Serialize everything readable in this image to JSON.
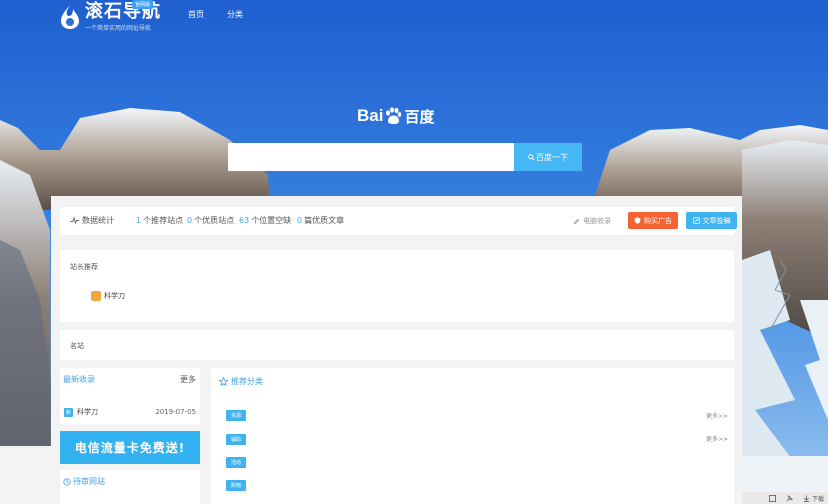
{
  "header": {
    "logo_title": "滚石导航",
    "logo_subtitle": "一个简单实用的网址导航",
    "logo_badge": "官网版",
    "nav": [
      "首页",
      "分类"
    ]
  },
  "search": {
    "brand_latin": "Bai",
    "brand_cn": "百度",
    "placeholder": "",
    "button_label": "百度一下"
  },
  "stats": {
    "label": "数据统计",
    "items": [
      {
        "num": "1",
        "text": "个推荐站点"
      },
      {
        "num": "0",
        "text": "个优质站点"
      },
      {
        "num": "63",
        "text": "个位置空缺"
      },
      {
        "num": "0",
        "text": "篇优质文章"
      }
    ],
    "fav_button": "电脑收录",
    "ad_button": "购买广告",
    "submit_button": "文章投稿"
  },
  "recommend": {
    "title": "站长推荐",
    "items": [
      "科学刀"
    ]
  },
  "famous": {
    "title": "名站"
  },
  "latest": {
    "title": "最新收录",
    "more": "更多",
    "rows": [
      {
        "tag": "新",
        "name": "科学刀",
        "date": "2019-07-05"
      }
    ]
  },
  "banner": {
    "text": "电信流量卡免费送!"
  },
  "pending": {
    "title": "待审网站"
  },
  "categories": {
    "title": "推荐分类",
    "tags": [
      "资源",
      "辅助",
      "活动",
      "购物"
    ],
    "more": "更多>>"
  },
  "footer": {
    "download": "下载"
  },
  "colors": {
    "accent": "#46b7f5",
    "ad": "#f26331",
    "link": "#46a0e0"
  }
}
